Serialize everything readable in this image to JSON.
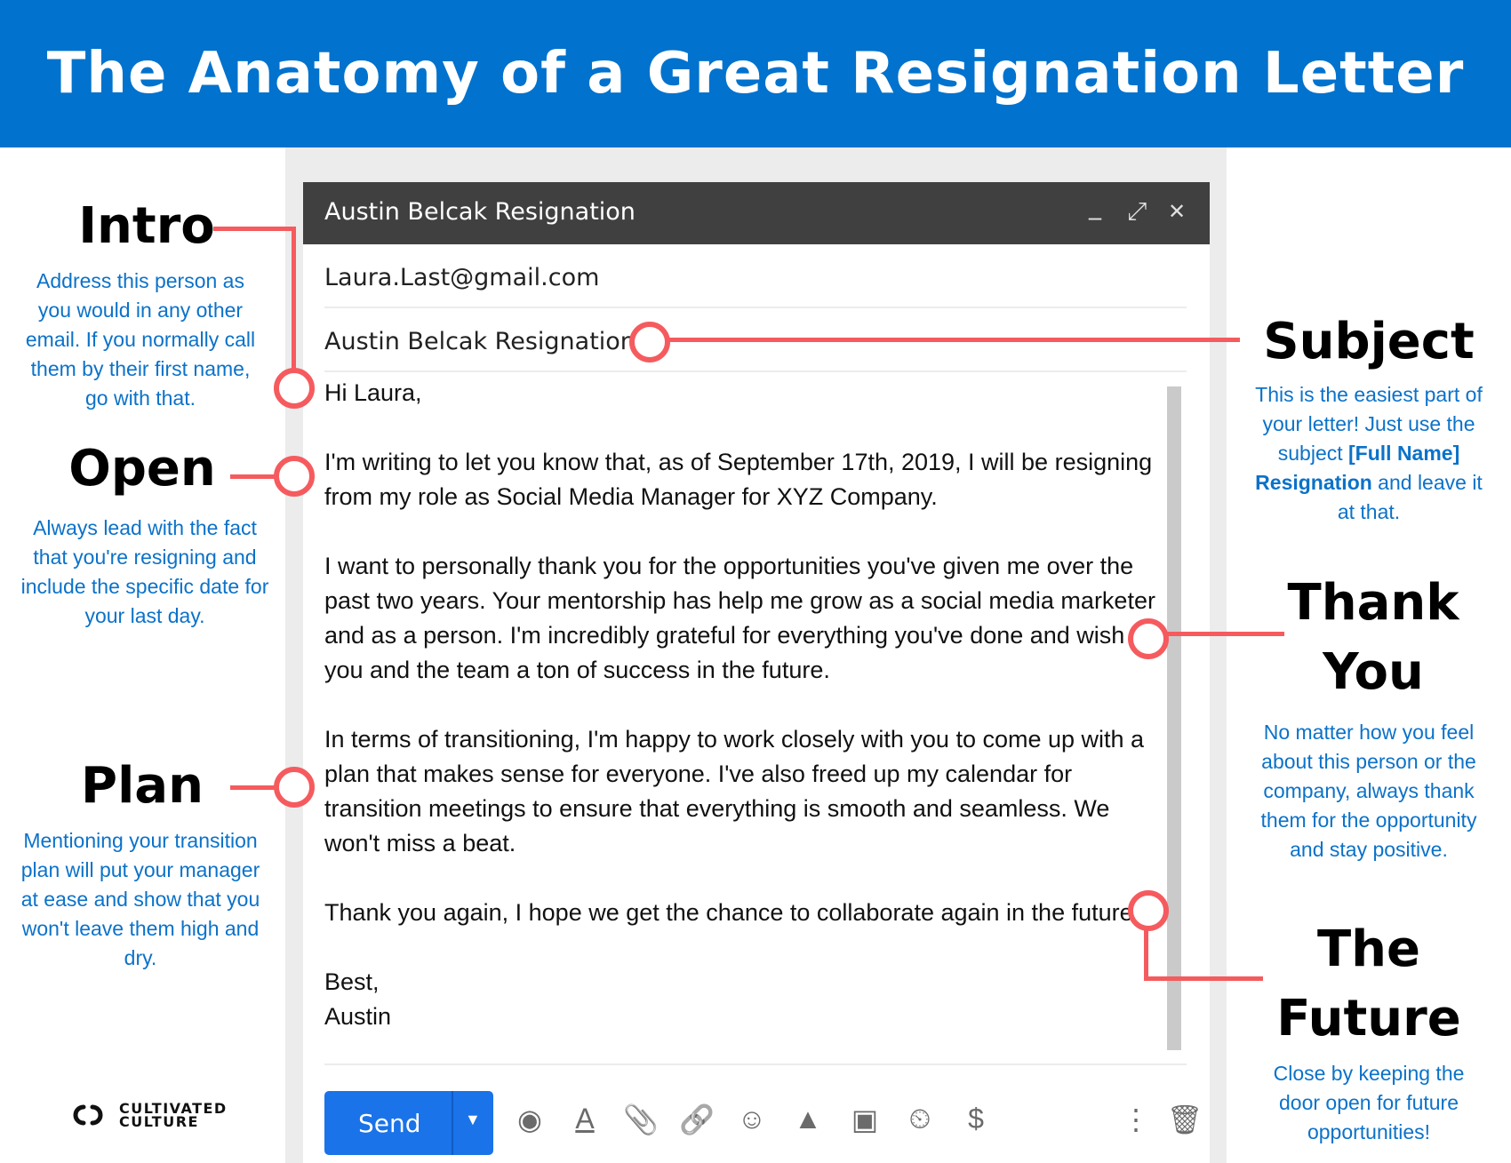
{
  "banner": {
    "title": "The Anatomy of a Great Resignation Letter"
  },
  "compose": {
    "window_title": "Austin Belcak Resignation",
    "controls": {
      "minimize": "_",
      "expand": "⤢",
      "close": "✕"
    },
    "to": "Laura.Last@gmail.com",
    "subject": "Austin Belcak Resignation",
    "greeting": "Hi Laura,",
    "paragraphs": [
      "I'm writing to let you know that, as of September 17th, 2019, I will be resigning from my role as Social Media Manager for XYZ Company.",
      "I want to personally thank you for the opportunities you've given me over the past two years. Your mentorship has help me grow as a social media marketer and as a person. I'm incredibly grateful for everything you've done and wish you and the team a ton of success in the future.",
      "In terms of transitioning, I'm happy to work closely with you to come up with a plan that makes sense for everyone. I've also freed up my calendar for transition meetings to ensure that everything is smooth and seamless. We won't miss a beat.",
      "Thank you again, I hope we get the chance to collaborate again in the future!"
    ],
    "signoff": "Best,",
    "signature": "Austin",
    "toolbar": {
      "send_label": "Send",
      "dropdown": "▼",
      "icons": {
        "confidential": "◉",
        "format": "A",
        "attach": "📎",
        "link": "🔗",
        "emoji": "☺",
        "drive": "▲",
        "photo": "▣",
        "schedule": "⏲",
        "money": "$",
        "more": "⋮",
        "trash": "🗑"
      }
    }
  },
  "annotations": {
    "intro": {
      "title": "Intro",
      "desc": "Address this person as you would in any other email. If you normally call them by their first name, go with that."
    },
    "open": {
      "title": "Open",
      "desc": "Always lead with the fact that you're resigning and include the specific date for your last day."
    },
    "plan": {
      "title": "Plan",
      "desc": "Mentioning your transition plan will put your manager at ease and show that you won't leave them high and dry."
    },
    "subject": {
      "title": "Subject",
      "desc_pre": "This is the easiest part of your letter! Just use the subject ",
      "desc_bold": "[Full Name] Resignation",
      "desc_post": " and leave it at that."
    },
    "thank_you": {
      "title_line1": "Thank",
      "title_line2": "You",
      "desc": "No matter how you feel about this person or the company, always thank them for the opportunity and stay positive."
    },
    "future": {
      "title_line1": "The",
      "title_line2": "Future",
      "desc": "Close by keeping the door open for future opportunities!"
    }
  },
  "logo": {
    "line1": "CULTIVATED",
    "line2": "CULTURE"
  },
  "colors": {
    "banner": "#0172cd",
    "accent": "#f55b5e",
    "desc_text": "#0b72c9",
    "send": "#1a73e8"
  }
}
